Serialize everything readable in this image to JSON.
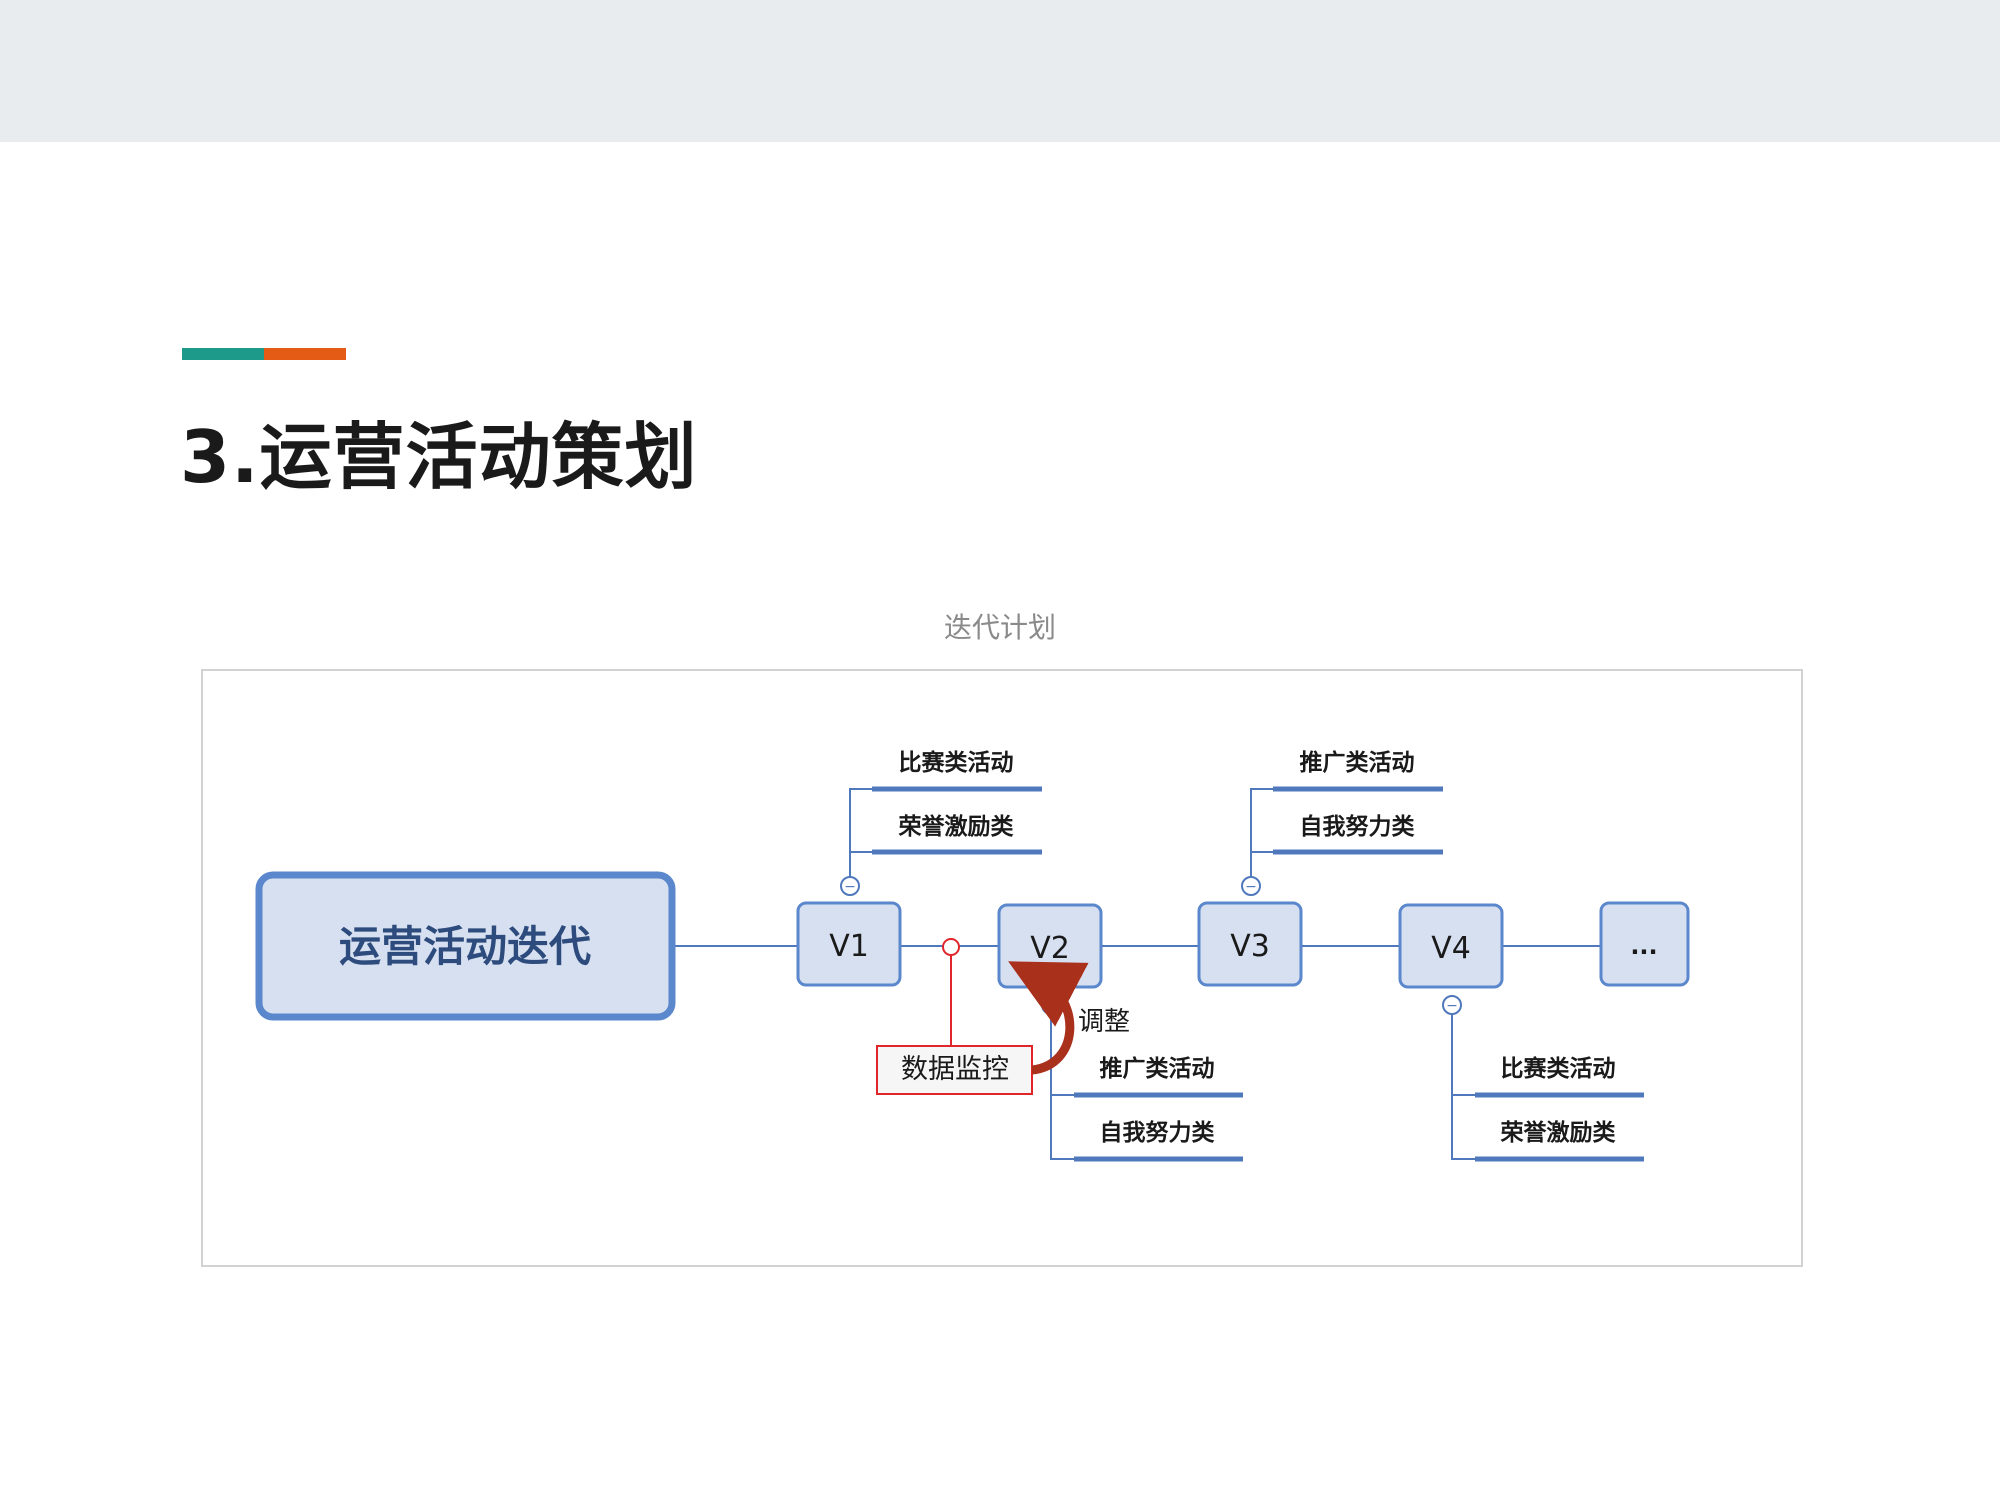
{
  "page": {
    "title": "3.运营活动策划",
    "caption": "迭代计划"
  },
  "diagram": {
    "root": "运营活动迭代",
    "versions": [
      "V1",
      "V2",
      "V3",
      "V4",
      "..."
    ],
    "v1_branches": [
      "比赛类活动",
      "荣誉激励类"
    ],
    "v2_branches": [
      "推广类活动",
      "自我努力类"
    ],
    "v3_branches": [
      "推广类活动",
      "自我努力类"
    ],
    "v4_branches": [
      "比赛类活动",
      "荣誉激励类"
    ],
    "monitor": "数据监控",
    "adjust": "调整",
    "collapse_symbol": "−"
  },
  "colors": {
    "node_fill": "#d6e0f1",
    "node_border": "#5b87cc",
    "node_text": "#2d4b7c",
    "line": "#4f78bd",
    "monitor_red": "#e0262b",
    "arrow": "#a9301b",
    "accent_teal": "#1e9a8a",
    "accent_orange": "#e35b15"
  }
}
